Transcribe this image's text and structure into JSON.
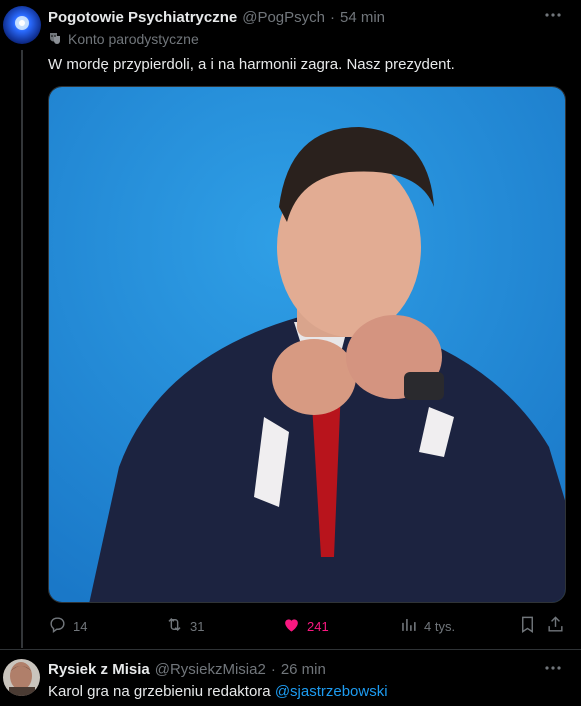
{
  "tweet1": {
    "author_name": "Pogotowie Psychiatryczne",
    "handle": "@PogPsych",
    "separator": "·",
    "time": "54 min",
    "parody_label": "Konto parodystyczne",
    "text": "W mordę przypierdoli, a i na harmonii zagra. Nasz prezydent.",
    "media_icon": "video-thumbnail",
    "actions": {
      "replies": "14",
      "reposts": "31",
      "likes": "241",
      "views": "4 tys."
    },
    "colors": {
      "like_active": "#f91880",
      "muted": "#71767b",
      "accent": "#1d9bf0"
    }
  },
  "tweet2": {
    "author_name": "Rysiek z Misia",
    "handle": "@RysiekzMisia2",
    "separator": "·",
    "time": "26 min",
    "text_prefix": "Karol gra na grzebieniu redaktora ",
    "mention": "@sjastrzebowski"
  }
}
